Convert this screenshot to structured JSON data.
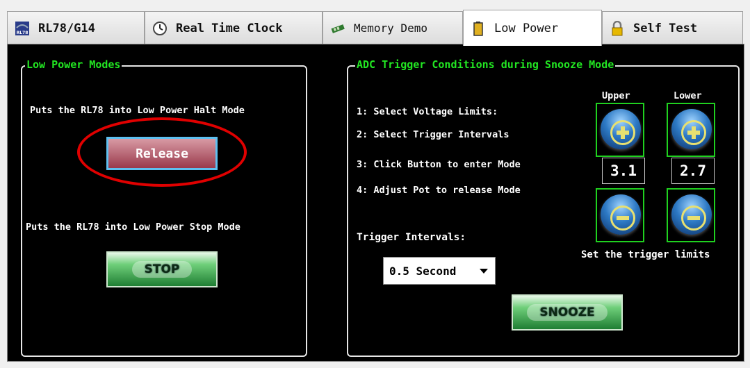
{
  "tabs": [
    {
      "label": "RL78/G14",
      "icon": "rl78-logo-icon"
    },
    {
      "label": "Real Time Clock",
      "icon": "clock-icon"
    },
    {
      "label": "Memory Demo",
      "icon": "memory-chip-icon"
    },
    {
      "label": "Low Power",
      "icon": "battery-icon",
      "active": true
    },
    {
      "label": "Self Test",
      "icon": "lock-icon"
    }
  ],
  "rl78_icon_text": "RL78",
  "low_power": {
    "legend": "Low Power Modes",
    "halt_text": "Puts the RL78 into Low Power Halt Mode",
    "release_label": "Release",
    "stop_text": "Puts the RL78 into Low Power Stop Mode",
    "stop_label": "STOP"
  },
  "adc": {
    "legend": "ADC Trigger Conditions during Snooze Mode",
    "steps": [
      "1: Select Voltage Limits:",
      "2: Select Trigger Intervals",
      "3: Click Button to enter Mode",
      "4: Adjust Pot to release Mode"
    ],
    "upper_label": "Upper",
    "lower_label": "Lower",
    "upper_value": "3.1",
    "lower_value": "2.7",
    "trigger_intervals_label": "Trigger Intervals:",
    "interval_selected": "0.5 Second",
    "set_limits_text": "Set the trigger limits",
    "snooze_label": "SNOOZE"
  },
  "colors": {
    "accent_green": "#22e622",
    "highlight_red": "#e00000",
    "release_border": "#5ec0f0"
  }
}
